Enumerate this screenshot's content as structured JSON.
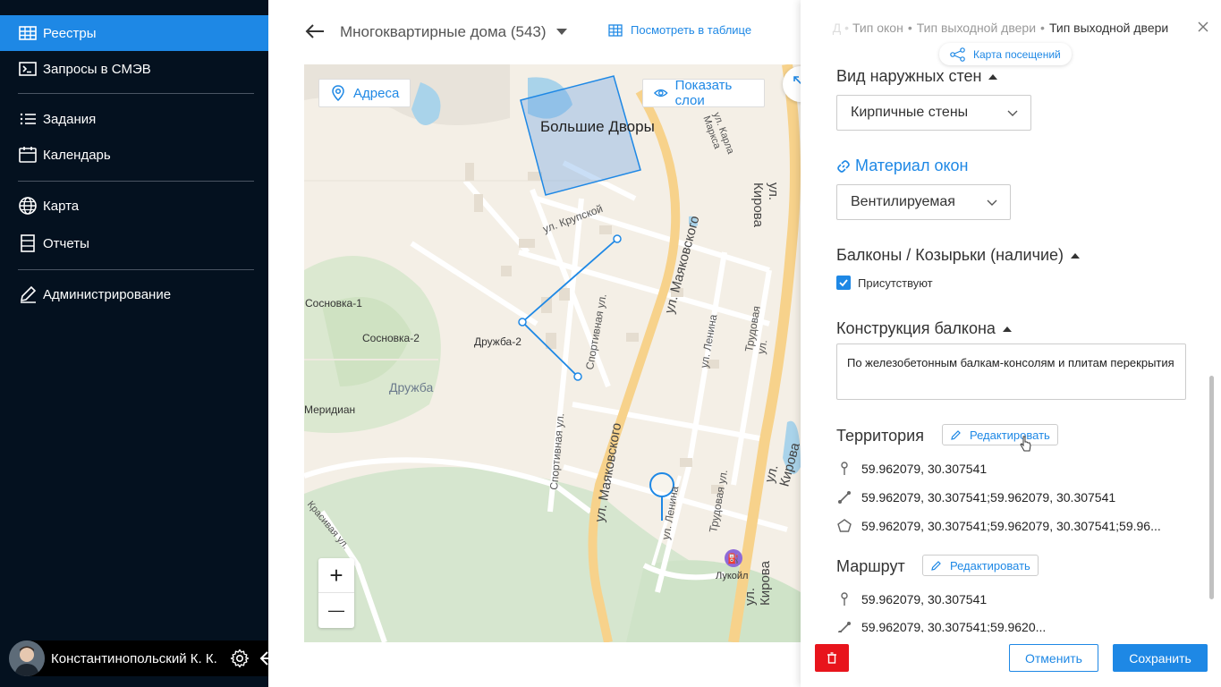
{
  "sidebar": {
    "items": [
      {
        "label": "Реестры",
        "icon": "table-icon"
      },
      {
        "label": "Запросы в СМЭВ",
        "icon": "terminal-icon"
      },
      {
        "label": "Задания",
        "icon": "list-icon"
      },
      {
        "label": "Календарь",
        "icon": "calendar-icon"
      },
      {
        "label": "Карта",
        "icon": "globe-icon"
      },
      {
        "label": "Отчеты",
        "icon": "report-icon"
      },
      {
        "label": "Администрирование",
        "icon": "pencil-icon"
      }
    ],
    "active_index": 0,
    "user": {
      "name": "Константинопольский К. К."
    }
  },
  "header": {
    "title": "Многоквартирные дома (543)",
    "view_table_label": "Посмотреть в таблице"
  },
  "map": {
    "addresses_button": "Адреса",
    "layers_button": "Показать слои",
    "labels": {
      "bolshie_dvory": "Большие Дворы",
      "krupskoy": "ул. Крупской",
      "karla_marksa": "ул. Карла Маркса",
      "kirova_top": "ул. Кирова",
      "kirova_mid": "ул. Кирова",
      "kirova_bottom": "ул. Кирова",
      "mayakovskogo_top": "ул. Маяковского",
      "mayakovskogo_bottom": "ул. Маяковского",
      "sportivnaya_top": "Спортивная ул.",
      "sportivnaya_bottom": "Спортивная ул.",
      "lenina_top": "ул. Ленина",
      "lenina_bottom": "ул. Ленина",
      "trudovaya_top": "Трудовая ул.",
      "trudovaya_bottom": "Трудовая ул.",
      "sosnovka1": "Сосновка-1",
      "sosnovka2": "Сосновка-2",
      "druzhba2": "Дружба-2",
      "druzhba": "Дружба",
      "meridian": "Меридиан",
      "krasivaya": "Красивая ул.",
      "lukoil": "Лукойл"
    },
    "zoom_in": "+",
    "zoom_out": "—"
  },
  "panel": {
    "breadcrumb": {
      "item1": "Тип окон",
      "item2": "Тип выходной двери",
      "current": "Тип выходной двери"
    },
    "visit_map_label": "Карта посещений",
    "wall_type": {
      "title": "Вид наружных стен",
      "value": "Кирпичные стены"
    },
    "window_material": {
      "title": "Материал окон",
      "value": "Вентилируемая"
    },
    "balconies": {
      "title": "Балконы / Козырьки (наличие)",
      "checkbox_label": "Присутствуют",
      "checked": true
    },
    "balcony_construction": {
      "title": "Конструкция балкона",
      "value": "По железобетонным балкам-консолям и плитам перекрытия"
    },
    "territory": {
      "title": "Территория",
      "edit_label": "Редактировать",
      "point": "59.962079, 30.307541",
      "line": "59.962079, 30.307541;59.962079, 30.307541",
      "polygon": "59.962079, 30.307541;59.962079, 30.307541;59.96..."
    },
    "route": {
      "title": "Маршрут",
      "edit_label": "Редактировать",
      "point": "59.962079, 30.307541",
      "line": "59.962079, 30.307541;59.9620..."
    },
    "actions": {
      "cancel": "Отменить",
      "save": "Сохранить"
    },
    "colors": {
      "primary": "#1e88e5",
      "danger": "#e8141c",
      "sidebar": "#04111f"
    }
  }
}
